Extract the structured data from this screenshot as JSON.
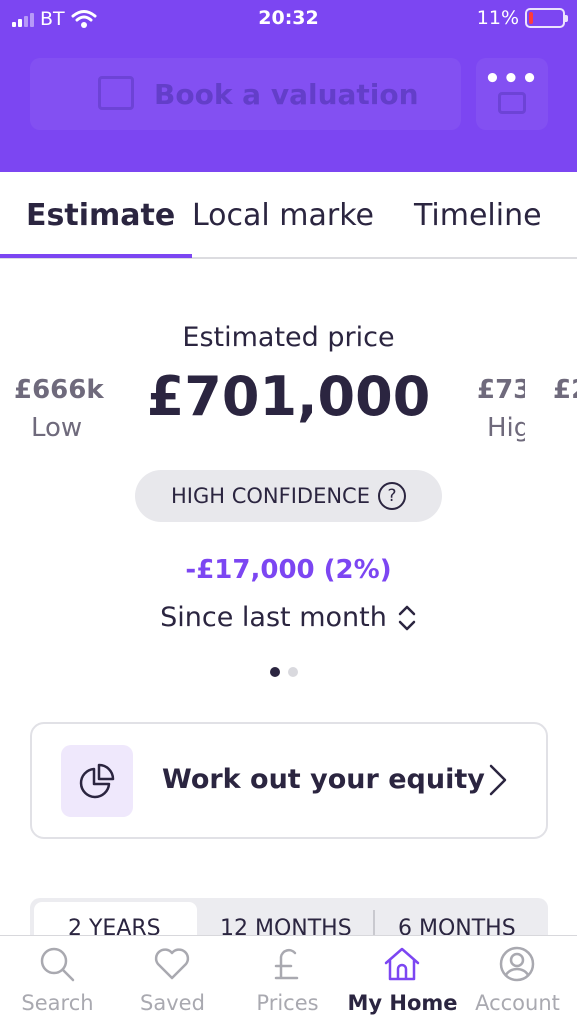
{
  "status_bar": {
    "carrier": "BT",
    "time": "20:32",
    "battery": "11%",
    "battery_level": 0.11,
    "signal_bars": 2
  },
  "header": {
    "book_label": "Book a valuation",
    "more_label": "•••"
  },
  "tabs": [
    {
      "label": "Estimate",
      "active": true
    },
    {
      "label": "Local marke",
      "active": false
    },
    {
      "label": "Timeline",
      "active": false
    }
  ],
  "estimate": {
    "label": "Estimated price",
    "price": "£701,000",
    "low_value": "£666k",
    "low_label": "Low",
    "high_value": "£73",
    "high_label": "Hig",
    "next_value": "£2",
    "confidence": "HIGH CONFIDENCE",
    "confidence_help": "?",
    "change": "-£17,000 (2%)",
    "since": "Since last month",
    "carousel_pages": 2,
    "carousel_active": 1
  },
  "equity": {
    "label": "Work out your equity"
  },
  "period": {
    "options": [
      "2 YEARS",
      "12 MONTHS",
      "6 MONTHS"
    ],
    "selected": "2 YEARS"
  },
  "nav": {
    "items": [
      {
        "label": "Search",
        "icon": "search-icon"
      },
      {
        "label": "Saved",
        "icon": "heart-icon"
      },
      {
        "label": "Prices",
        "icon": "pound-icon"
      },
      {
        "label": "My Home",
        "icon": "home-icon"
      },
      {
        "label": "Account",
        "icon": "account-icon"
      }
    ],
    "active": "My Home"
  },
  "colors": {
    "brand": "#7c46f2",
    "text": "#2b2540",
    "muted": "#a9a9b0",
    "battery_low": "#ff3b3b"
  }
}
